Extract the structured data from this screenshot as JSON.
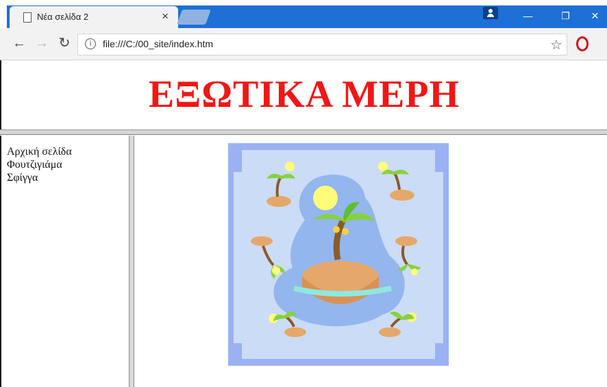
{
  "browser": {
    "tab_title": "Νέα σελίδα 2",
    "url": "file:///C:/00_site/index.htm"
  },
  "page": {
    "title": "ΕΞΩΤΙΚΑ ΜΕΡΗ",
    "nav_items": [
      "Αρχική σελίδα",
      "Φουτζιγιάμα",
      "Σφίγγα"
    ]
  },
  "colors": {
    "titlebar": "#1e6fd6",
    "heading": "#f21616",
    "art_border": "#9ab2f3",
    "art_inner": "#cbdcf6",
    "island_water": "#93b6ee",
    "sun": "#fffc7a"
  },
  "icons": {
    "tab_page": "page-icon",
    "back": "back-arrow-icon",
    "forward": "forward-arrow-icon",
    "reload": "reload-icon",
    "info": "info-icon",
    "bookmark": "star-icon",
    "extension": "opera-icon"
  }
}
